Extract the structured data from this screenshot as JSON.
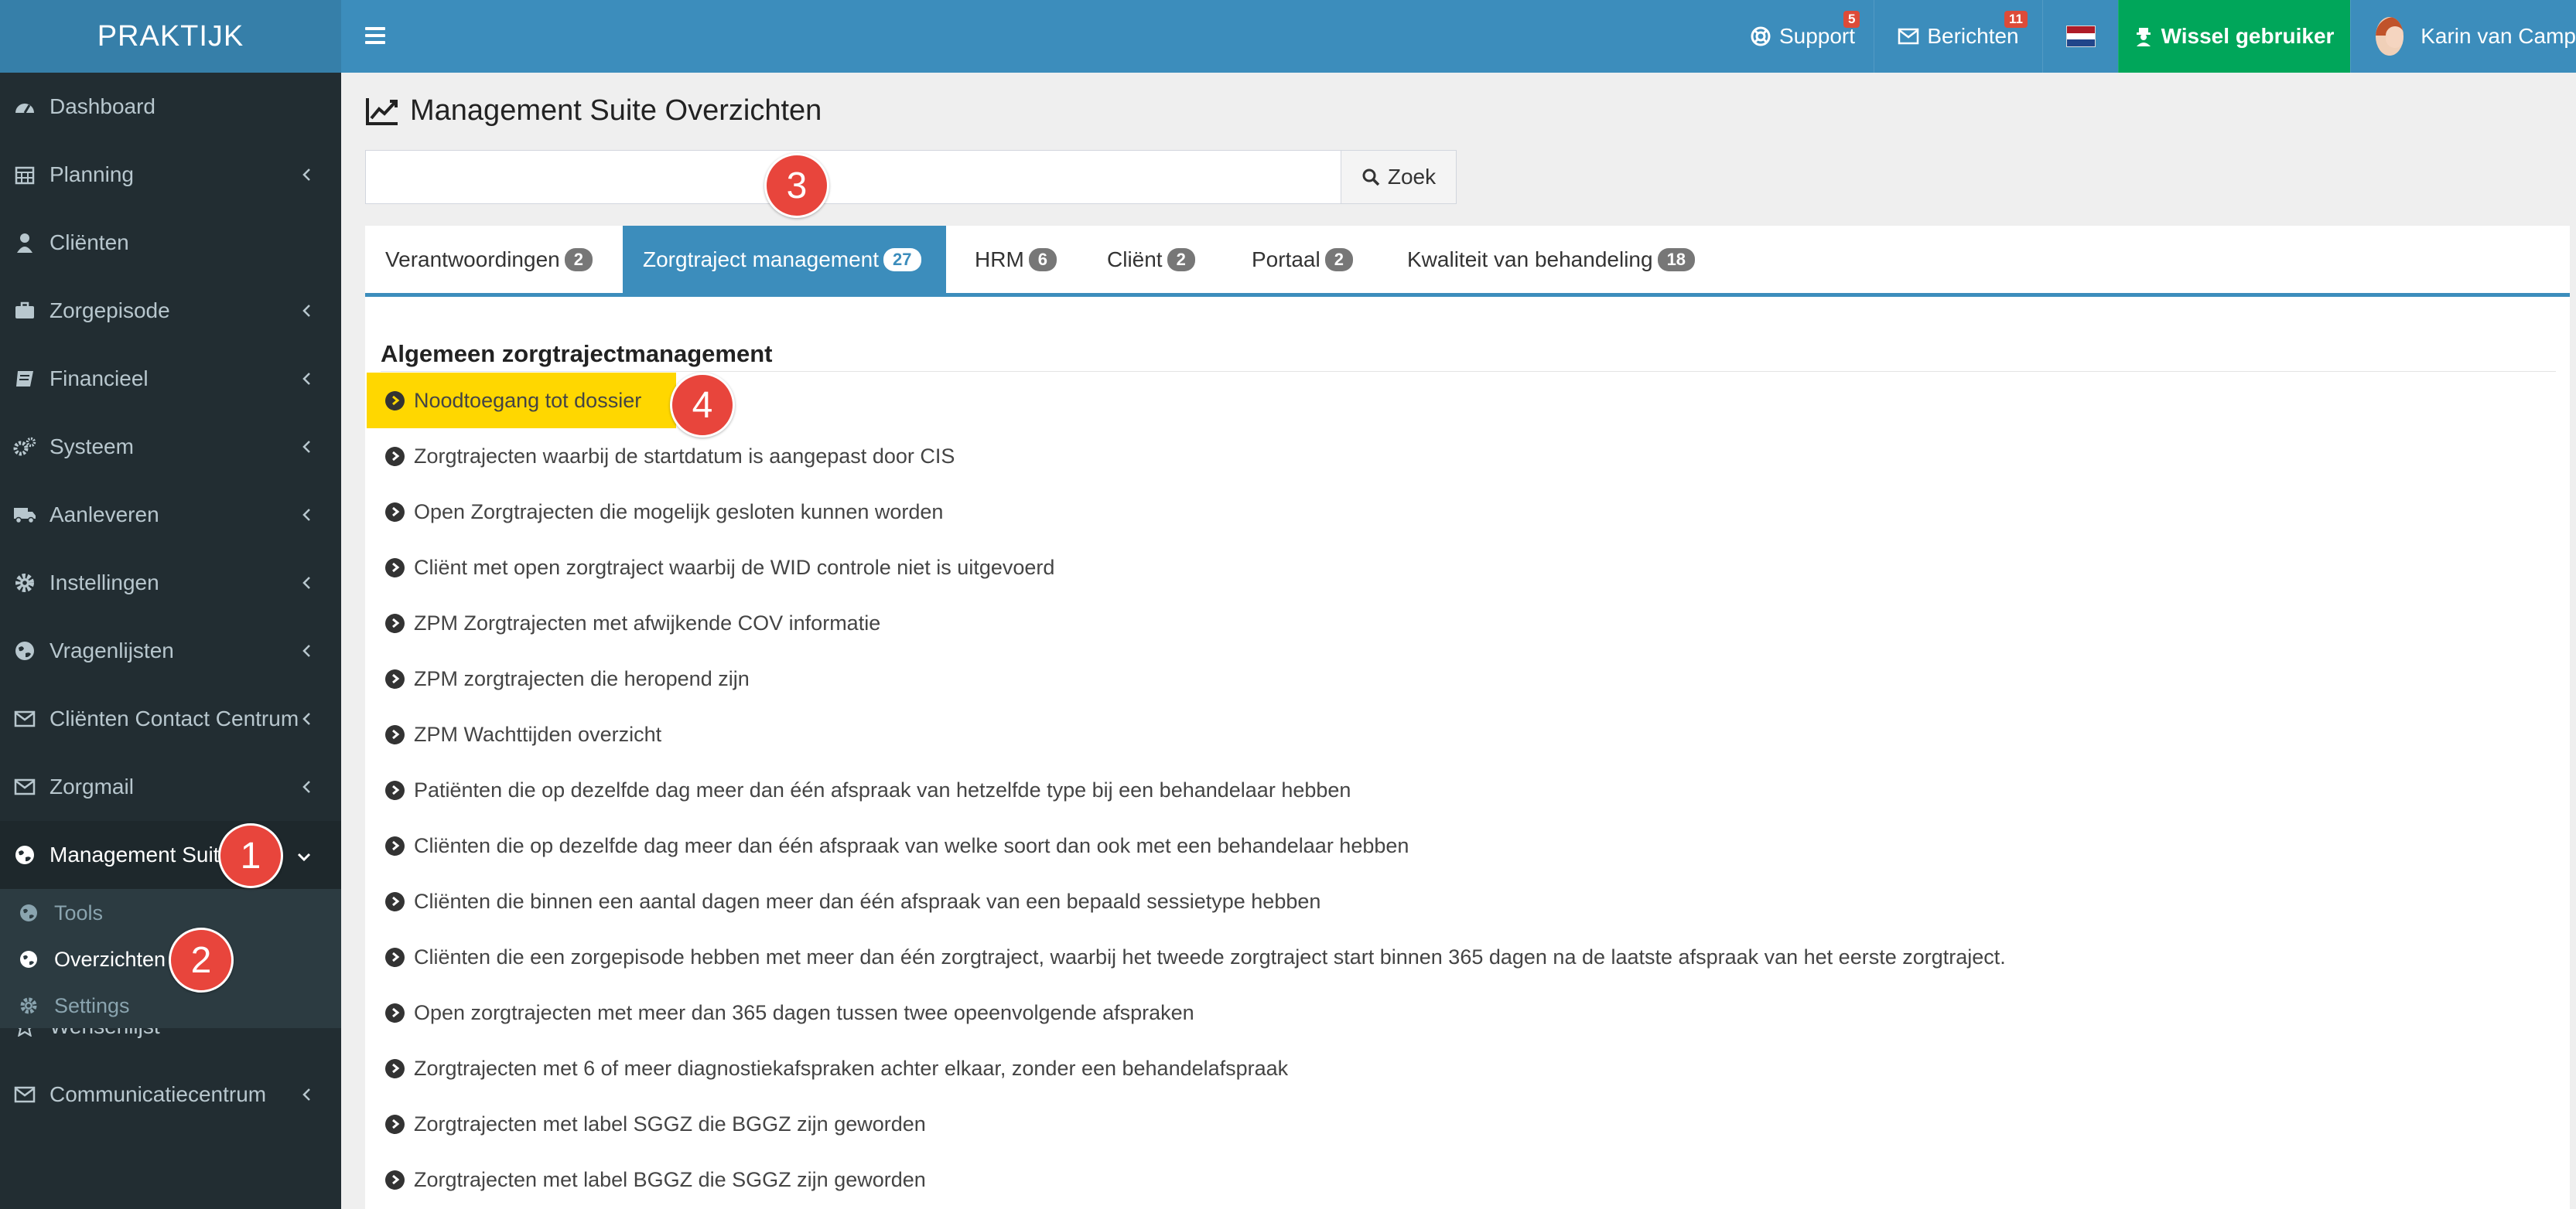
{
  "app": {
    "logo": "PRAKTIJK"
  },
  "topnav": {
    "support_label": "Support",
    "support_badge": "5",
    "messages_label": "Berichten",
    "messages_badge": "11",
    "switch_user_label": "Wissel gebruiker",
    "user_name": "Karin van Camp"
  },
  "sidebar": {
    "items": [
      {
        "label": "Dashboard",
        "icon": "dashboard-icon"
      },
      {
        "label": "Planning",
        "icon": "calendar-icon"
      },
      {
        "label": "Cliënten",
        "icon": "user-icon"
      },
      {
        "label": "Zorgepisode",
        "icon": "briefcase-icon"
      },
      {
        "label": "Financieel",
        "icon": "book-icon"
      },
      {
        "label": "Systeem",
        "icon": "cogs-icon"
      },
      {
        "label": "Aanleveren",
        "icon": "truck-icon"
      },
      {
        "label": "Instellingen",
        "icon": "gear-icon"
      },
      {
        "label": "Vragenlijsten",
        "icon": "globe-icon"
      },
      {
        "label": "Cliënten Contact Centrum",
        "icon": "envelope-icon"
      },
      {
        "label": "Zorgmail",
        "icon": "envelope-icon"
      },
      {
        "label": "Management Suite",
        "icon": "globe-icon"
      },
      {
        "label": "Wensenlijst",
        "icon": "star-icon"
      },
      {
        "label": "Communicatiecentrum",
        "icon": "envelope-icon"
      }
    ],
    "submenu": [
      {
        "label": "Tools",
        "icon": "globe-icon"
      },
      {
        "label": "Overzichten",
        "icon": "globe-icon"
      },
      {
        "label": "Settings",
        "icon": "gear-icon"
      }
    ]
  },
  "markers": [
    "1",
    "2",
    "3",
    "4"
  ],
  "page": {
    "title": "Management Suite Overzichten",
    "search_value": "",
    "search_button": "Zoek"
  },
  "tabs": [
    {
      "label": "Verantwoordingen",
      "count": "2"
    },
    {
      "label": "Zorgtraject management",
      "count": "27"
    },
    {
      "label": "HRM",
      "count": "6"
    },
    {
      "label": "Cliënt",
      "count": "2"
    },
    {
      "label": "Portaal",
      "count": "2"
    },
    {
      "label": "Kwaliteit van behandeling",
      "count": "18"
    }
  ],
  "section": {
    "title": "Algemeen zorgtrajectmanagement",
    "reports": [
      "Noodtoegang tot dossier",
      "Zorgtrajecten waarbij de startdatum is aangepast door CIS",
      "Open Zorgtrajecten die mogelijk gesloten kunnen worden",
      "Cliënt met open zorgtraject waarbij de WID controle niet is uitgevoerd",
      "ZPM Zorgtrajecten met afwijkende COV informatie",
      "ZPM zorgtrajecten die heropend zijn",
      "ZPM Wachttijden overzicht",
      "Patiënten die op dezelfde dag meer dan één afspraak van hetzelfde type bij een behandelaar hebben",
      "Cliënten die op dezelfde dag meer dan één afspraak van welke soort dan ook met een behandelaar hebben",
      "Cliënten die binnen een aantal dagen meer dan één afspraak van een bepaald sessietype hebben",
      "Cliënten die een zorgepisode hebben met meer dan één zorgtraject, waarbij het tweede zorgtraject start binnen 365 dagen na de laatste afspraak van het eerste zorgtraject.",
      "Open zorgtrajecten met meer dan 365 dagen tussen twee opeenvolgende afspraken",
      "Zorgtrajecten met 6 of meer diagnostiekafspraken achter elkaar, zonder een behandelafspraak",
      "Zorgtrajecten met label SGGZ die BGGZ zijn geworden",
      "Zorgtrajecten met label BGGZ die SGGZ zijn geworden"
    ]
  },
  "colors": {
    "header_blue": "#3c8dbc",
    "sidebar_dark": "#222d32",
    "switch_green": "#00a65a",
    "highlight_yellow": "#ffd700",
    "marker_red": "#e8453c"
  }
}
